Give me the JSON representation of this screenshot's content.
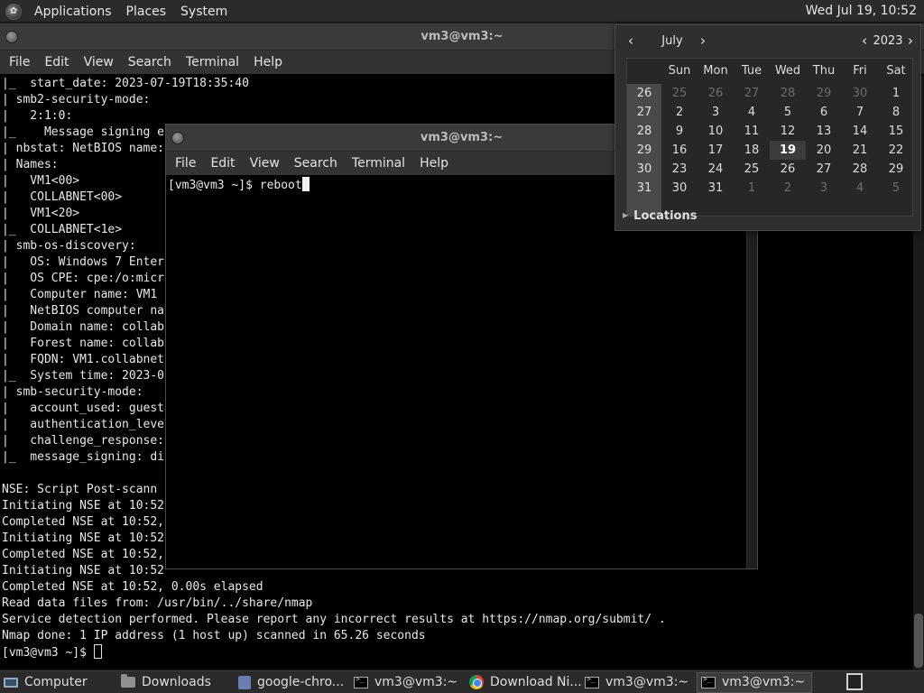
{
  "top_panel": {
    "menus": [
      "Applications",
      "Places",
      "System"
    ],
    "clock": "Wed Jul 19, 10:52"
  },
  "back_terminal": {
    "title": "vm3@vm3:~",
    "menu": [
      "File",
      "Edit",
      "View",
      "Search",
      "Terminal",
      "Help"
    ],
    "lines": [
      "|_  start_date: 2023-07-19T18:35:40",
      "| smb2-security-mode:",
      "|   2:1:0:",
      "|_    Message signing e",
      "| nbstat: NetBIOS name:",
      "| Names:",
      "|   VM1<00>",
      "|   COLLABNET<00>",
      "|   VM1<20>",
      "|_  COLLABNET<1e>",
      "| smb-os-discovery:",
      "|   OS: Windows 7 Enter",
      "|   OS CPE: cpe:/o:micr",
      "|   Computer name: VM1",
      "|   NetBIOS computer na",
      "|   Domain name: collab",
      "|   Forest name: collab",
      "|   FQDN: VM1.collabnet",
      "|_  System time: 2023-0",
      "| smb-security-mode:",
      "|   account_used: guest",
      "|   authentication_leve",
      "|   challenge_response:",
      "|_  message_signing: di",
      "",
      "NSE: Script Post-scann",
      "Initiating NSE at 10:52",
      "Completed NSE at 10:52,",
      "Initiating NSE at 10:52",
      "Completed NSE at 10:52,",
      "Initiating NSE at 10:52",
      "Completed NSE at 10:52, 0.00s elapsed",
      "Read data files from: /usr/bin/../share/nmap",
      "Service detection performed. Please report any incorrect results at https://nmap.org/submit/ .",
      "Nmap done: 1 IP address (1 host up) scanned in 65.26 seconds"
    ],
    "prompt": "[vm3@vm3 ~]$ "
  },
  "front_terminal": {
    "title": "vm3@vm3:~",
    "menu": [
      "File",
      "Edit",
      "View",
      "Search",
      "Terminal",
      "Help"
    ],
    "prompt": "[vm3@vm3 ~]$ ",
    "command": "reboot"
  },
  "calendar": {
    "month": "July",
    "year": "2023",
    "weekdays": [
      "Sun",
      "Mon",
      "Tue",
      "Wed",
      "Thu",
      "Fri",
      "Sat"
    ],
    "weeks": [
      {
        "week": "26",
        "days": [
          {
            "d": "25",
            "dim": true
          },
          {
            "d": "26",
            "dim": true
          },
          {
            "d": "27",
            "dim": true
          },
          {
            "d": "28",
            "dim": true
          },
          {
            "d": "29",
            "dim": true
          },
          {
            "d": "30",
            "dim": true
          },
          {
            "d": "1"
          }
        ]
      },
      {
        "week": "27",
        "days": [
          {
            "d": "2"
          },
          {
            "d": "3"
          },
          {
            "d": "4"
          },
          {
            "d": "5"
          },
          {
            "d": "6"
          },
          {
            "d": "7"
          },
          {
            "d": "8"
          }
        ]
      },
      {
        "week": "28",
        "days": [
          {
            "d": "9"
          },
          {
            "d": "10"
          },
          {
            "d": "11"
          },
          {
            "d": "12"
          },
          {
            "d": "13"
          },
          {
            "d": "14"
          },
          {
            "d": "15"
          }
        ]
      },
      {
        "week": "29",
        "days": [
          {
            "d": "16"
          },
          {
            "d": "17"
          },
          {
            "d": "18"
          },
          {
            "d": "19",
            "today": true
          },
          {
            "d": "20"
          },
          {
            "d": "21"
          },
          {
            "d": "22"
          }
        ]
      },
      {
        "week": "30",
        "days": [
          {
            "d": "23"
          },
          {
            "d": "24"
          },
          {
            "d": "25"
          },
          {
            "d": "26"
          },
          {
            "d": "27"
          },
          {
            "d": "28"
          },
          {
            "d": "29"
          }
        ]
      },
      {
        "week": "31",
        "days": [
          {
            "d": "30"
          },
          {
            "d": "31"
          },
          {
            "d": "1",
            "dim": true
          },
          {
            "d": "2",
            "dim": true
          },
          {
            "d": "3",
            "dim": true
          },
          {
            "d": "4",
            "dim": true
          },
          {
            "d": "5",
            "dim": true
          }
        ]
      }
    ],
    "locations_label": "Locations"
  },
  "taskbar": {
    "items": [
      {
        "label": "Computer",
        "icon": "computer-icon"
      },
      {
        "label": "Downloads",
        "icon": "folder-icon"
      },
      {
        "label": "google-chro...",
        "icon": "script-icon"
      },
      {
        "label": "vm3@vm3:~",
        "icon": "terminal-icon"
      },
      {
        "label": "Download Ni...",
        "icon": "chrome-icon"
      },
      {
        "label": "vm3@vm3:~",
        "icon": "terminal-icon"
      },
      {
        "label": "vm3@vm3:~",
        "icon": "terminal-icon",
        "active": true
      }
    ]
  }
}
